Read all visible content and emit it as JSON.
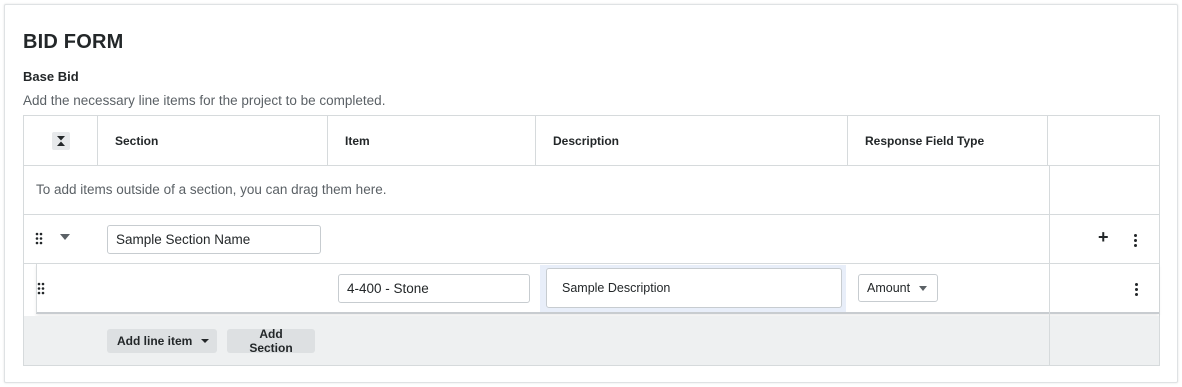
{
  "form": {
    "title": "BID FORM",
    "section_title": "Base Bid",
    "helper_text": "Add the necessary line items for the project to be completed."
  },
  "table": {
    "columns": [
      "Section",
      "Item",
      "Description",
      "Response Field Type"
    ],
    "drop_hint": "To add items outside of a section, you can drag them here.",
    "section_row": {
      "name_value": "Sample Section Name"
    },
    "line_item": {
      "item_value": "4-400 - Stone",
      "description_value": "Sample Description",
      "response_type": "Amount"
    }
  },
  "footer": {
    "add_line_item_label": "Add line item",
    "add_section_label": "Add Section"
  },
  "icons": {
    "collapse": "collapse-all-icon",
    "drag": "drag-handle-icon",
    "caret": "caret-down-icon",
    "add": "plus-icon",
    "more": "kebab-menu-icon"
  },
  "colors": {
    "accent_highlight": "#e8eef9",
    "button_bg": "#dde0e2",
    "footer_bg": "#eef0f1"
  }
}
